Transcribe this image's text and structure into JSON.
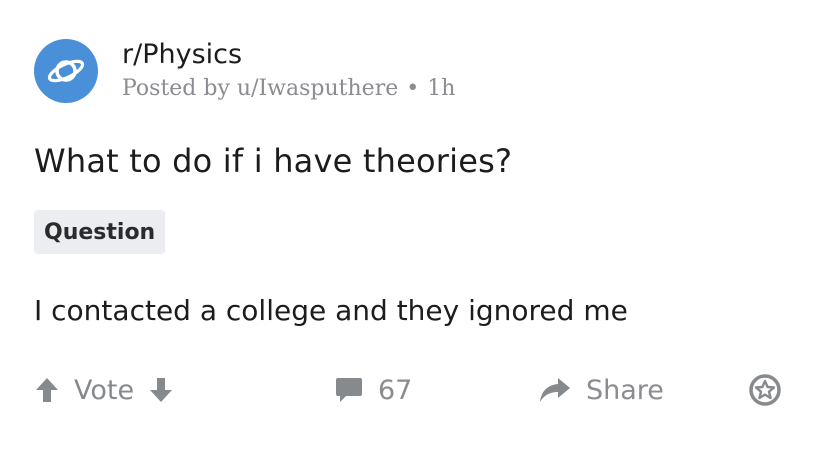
{
  "subreddit": {
    "name": "r/Physics",
    "icon": "planet-icon",
    "avatar_color": "#4a90d9"
  },
  "post": {
    "posted_by_prefix": "Posted by",
    "author": "u/Iwasputhere",
    "separator": "•",
    "age": "1h",
    "title": "What to do if i have theories?",
    "flair": "Question",
    "body": "I contacted a college and they ignored me"
  },
  "actions": {
    "upvote_icon": "arrow-up-icon",
    "vote_label": "Vote",
    "downvote_icon": "arrow-down-icon",
    "comments_icon": "comment-bubble-icon",
    "comments_count": "67",
    "share_icon": "share-arrow-icon",
    "share_label": "Share",
    "award_icon": "award-star-icon"
  },
  "colors": {
    "muted_text": "#8a8c8f",
    "flair_bg": "#ebedf0"
  }
}
